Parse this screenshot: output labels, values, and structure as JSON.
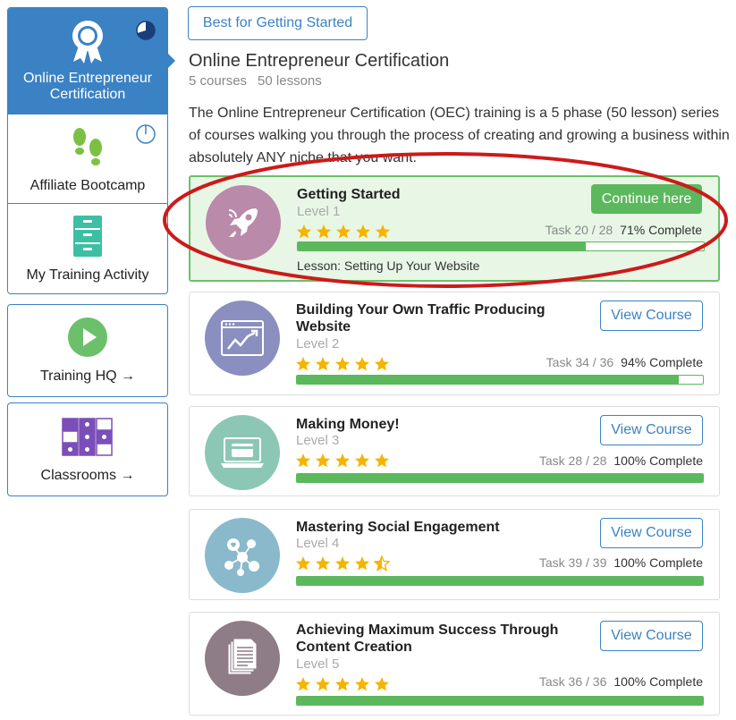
{
  "sidebar": {
    "group1": [
      {
        "label_line1": "Online Entrepreneur",
        "label_line2": "Certification",
        "icon": "award-ribbon-icon",
        "active": true,
        "progress": 0.71
      },
      {
        "label": "Affiliate Bootcamp",
        "icon": "footprints-icon",
        "progress": 0.05
      },
      {
        "label": "My Training Activity",
        "icon": "filing-cabinet-icon"
      }
    ],
    "training_hq": {
      "label": "Training HQ →",
      "icon": "play-circle-icon"
    },
    "classrooms": {
      "label": "Classrooms →",
      "icon": "classroom-grid-icon"
    }
  },
  "filter": {
    "label": "Best for Getting Started"
  },
  "certification": {
    "title": "Online Entrepreneur Certification",
    "courses": "5 courses",
    "lessons": "50 lessons",
    "description": "The Online Entrepreneur Certification (OEC) training is a 5 phase (50 lesson) series of courses walking you through the process of creating and growing a business within absolutely ANY niche that you want."
  },
  "courses": [
    {
      "title": "Getting Started",
      "level": "Level 1",
      "task": "Task 20 / 28",
      "percent": "71% Complete",
      "progress": 0.71,
      "rating": 5,
      "button": "Continue here",
      "lesson": "Lesson: Setting Up Your Website",
      "icon": "rocket-icon",
      "color": "#b98aa9"
    },
    {
      "title": "Building Your Own Traffic Producing Website",
      "level": "Level 2",
      "task": "Task 34 / 36",
      "percent": "94% Complete",
      "progress": 0.94,
      "rating": 5,
      "button": "View Course",
      "icon": "website-growth-icon",
      "color": "#8b8fbf"
    },
    {
      "title": "Making Money!",
      "level": "Level 3",
      "task": "Task 28 / 28",
      "percent": "100% Complete",
      "progress": 1.0,
      "rating": 5,
      "button": "View Course",
      "icon": "credit-card-laptop-icon",
      "color": "#8cc7b5"
    },
    {
      "title": "Mastering Social Engagement",
      "level": "Level 4",
      "task": "Task 39 / 39",
      "percent": "100% Complete",
      "progress": 1.0,
      "rating": 4.5,
      "button": "View Course",
      "icon": "social-network-icon",
      "color": "#8ab9cc"
    },
    {
      "title": "Achieving Maximum Success Through Content Creation",
      "level": "Level 5",
      "task": "Task 36 / 36",
      "percent": "100% Complete",
      "progress": 1.0,
      "rating": 5,
      "button": "View Course",
      "icon": "documents-icon",
      "color": "#8e7c86"
    }
  ],
  "colors": {
    "accent": "#3b82c4",
    "success": "#5cb85c",
    "star": "#f5b400",
    "highlight": "#cc1a1a"
  }
}
